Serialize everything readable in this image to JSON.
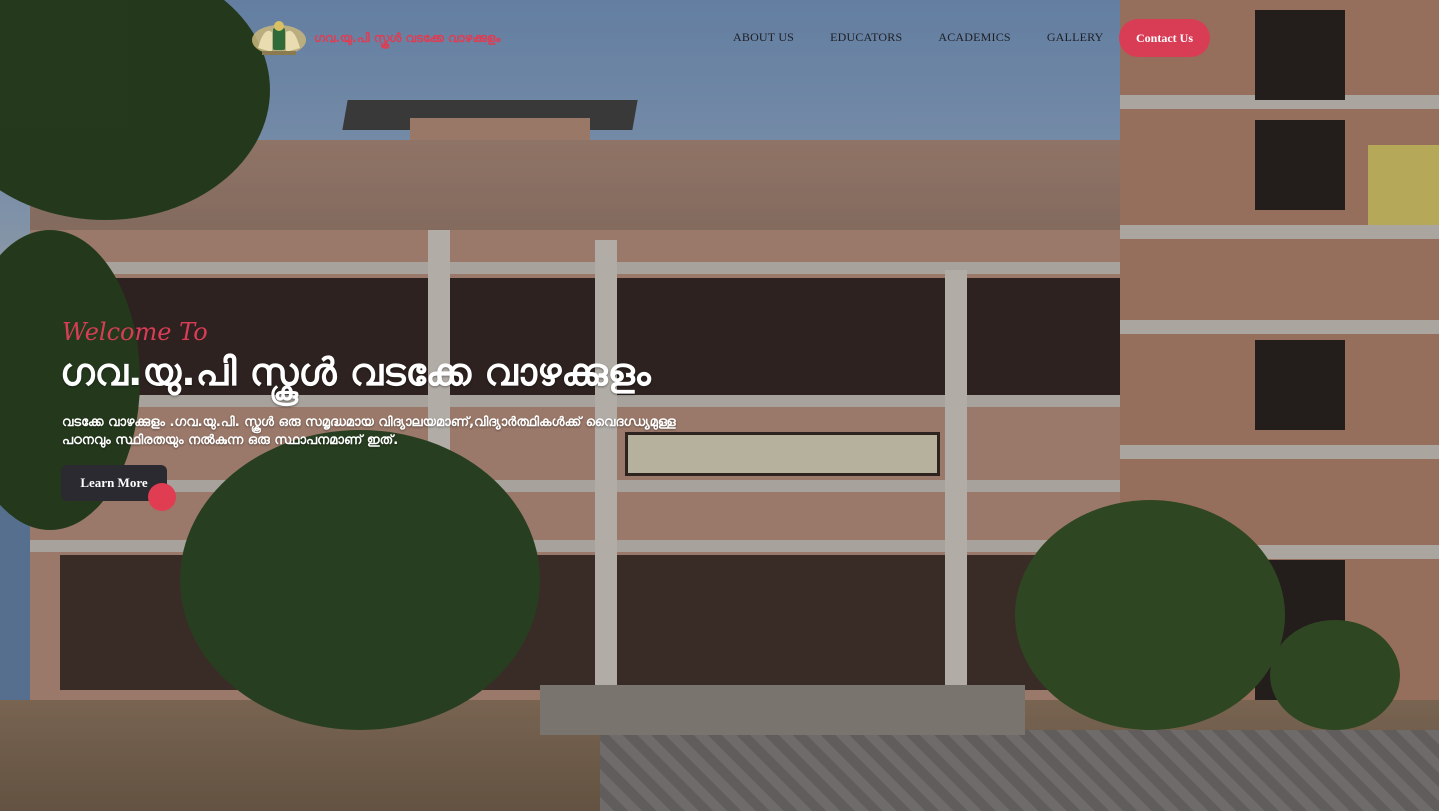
{
  "header": {
    "brand_name": "ഗവ.യു.പി സ്കൂൾ വടക്കേ വാഴക്കുളം",
    "nav": [
      {
        "label": "ABOUT US"
      },
      {
        "label": "EDUCATORS"
      },
      {
        "label": "ACADEMICS"
      },
      {
        "label": "GALLERY"
      }
    ],
    "cta_label": "Contact Us"
  },
  "hero": {
    "welcome": "Welcome To",
    "title": "ഗവ.യു.പി സ്കൂൾ വടക്കേ വാഴക്കുളം",
    "description": "വടക്കേ വാഴക്കുളം .ഗവ.യു.പി. സ്കൂൾ ഒരു സമൃദ്ധമായ വിദ്യാലയമാണ്,വിദ്യാർത്ഥികൾക്ക് വൈദഗ്ധ്യമുള്ള പഠനവും സ്ഥിരതയും നൽകുന്ന ഒരു സ്ഥാപനമാണ് ഇത്.",
    "button_label": "Learn More"
  },
  "colors": {
    "accent": "#d93d56",
    "dark_button": "#2a2a30"
  },
  "icons": {
    "emblem": "kerala-emblem-icon"
  }
}
